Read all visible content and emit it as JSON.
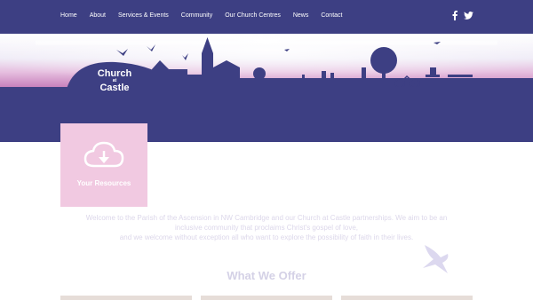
{
  "nav": {
    "items": [
      {
        "label": "Home"
      },
      {
        "label": "About"
      },
      {
        "label": "Services & Events"
      },
      {
        "label": "Community"
      },
      {
        "label": "Our Church Centres"
      },
      {
        "label": "News"
      },
      {
        "label": "Contact"
      }
    ]
  },
  "social": {
    "facebook_icon": "facebook-icon",
    "twitter_icon": "twitter-icon"
  },
  "logo": {
    "line1": "Church",
    "line2": "at",
    "line3": "Castle"
  },
  "resources": {
    "label": "Your Resources",
    "icon": "cloud-download-icon"
  },
  "welcome": {
    "line1": "Welcome to the Parish of the Ascension in NW Cambridge and our Church at Castle partnerships. We aim to be an",
    "line2": "inclusive community that proclaims Christ's gospel of love,",
    "line3": "and we welcome without exception all who want to explore the possibility of faith in their lives."
  },
  "offer": {
    "title": "What We Offer"
  },
  "colors": {
    "primary": "#3d3f83",
    "pink": "#f1c9e1",
    "text_faint": "#dcd7ea"
  }
}
